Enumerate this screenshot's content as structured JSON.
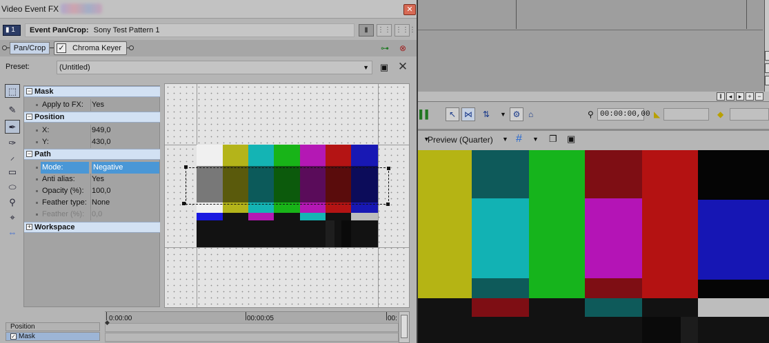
{
  "dialog": {
    "title": "Video Event FX",
    "close_icon": "close-icon",
    "event_badge": "1",
    "event_label": "Event Pan/Crop:",
    "event_name": "Sony Test Pattern 1"
  },
  "plugin_chain": {
    "items": [
      "Pan/Crop",
      "Chroma Keyer"
    ]
  },
  "preset": {
    "label": "Preset:",
    "value": "(Untitled)"
  },
  "properties": {
    "mask": {
      "label": "Mask",
      "apply_to_fx_label": "Apply to FX:",
      "apply_to_fx_value": "Yes"
    },
    "position": {
      "label": "Position",
      "x_label": "X:",
      "x_value": "949,0",
      "y_label": "Y:",
      "y_value": "430,0"
    },
    "path": {
      "label": "Path",
      "mode_label": "Mode:",
      "mode_value": "Negative",
      "anti_alias_label": "Anti alias:",
      "anti_alias_value": "Yes",
      "opacity_label": "Opacity (%):",
      "opacity_value": "100,0",
      "feather_type_label": "Feather type:",
      "feather_type_value": "None",
      "feather_label": "Feather (%):",
      "feather_value": "0,0"
    },
    "workspace": {
      "label": "Workspace"
    }
  },
  "timeline": {
    "tracks": [
      "Position",
      "Mask"
    ],
    "ruler": [
      "0:00:00",
      "00:00:05",
      "00:"
    ]
  },
  "preview": {
    "timecode": "00:00:00,00",
    "quality": "Preview (Quarter)"
  },
  "colors": {
    "accent_selected": "#4a97d6",
    "category_bg": "#d2e1f3"
  }
}
